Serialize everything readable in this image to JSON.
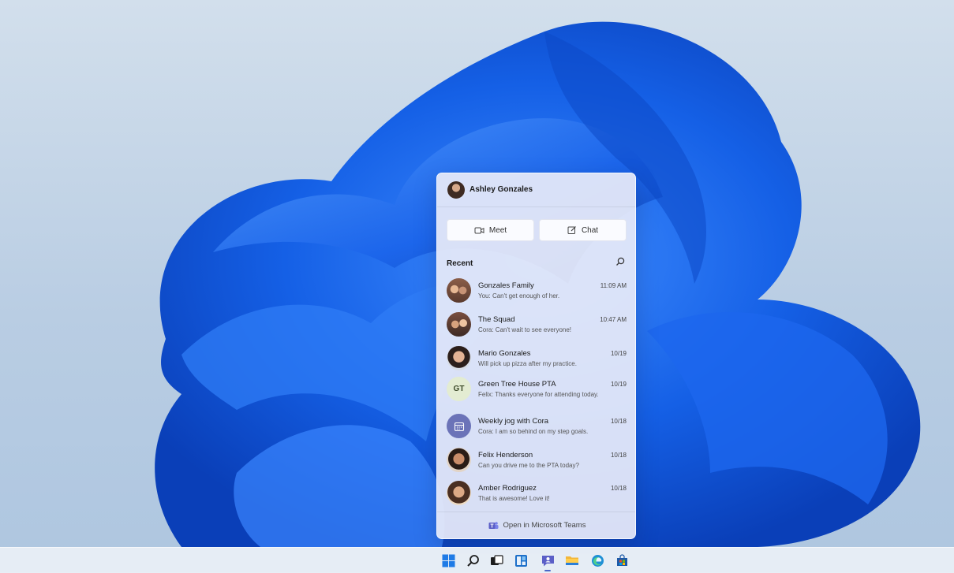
{
  "user": {
    "name": "Ashley Gonzales"
  },
  "actions": {
    "meet_label": "Meet",
    "chat_label": "Chat"
  },
  "recent": {
    "label": "Recent",
    "items": [
      {
        "title": "Gonzales Family",
        "time": "11:09 AM",
        "preview": "You: Can't get enough of her.",
        "avatar": "photo-group"
      },
      {
        "title": "The Squad",
        "time": "10:47 AM",
        "preview": "Cora: Can't wait to see everyone!",
        "avatar": "photo-group"
      },
      {
        "title": "Mario Gonzales",
        "time": "10/19",
        "preview": "Will pick up pizza after my practice.",
        "avatar": "photo"
      },
      {
        "title": "Green Tree House PTA",
        "time": "10/19",
        "preview": "Felix: Thanks everyone for attending today.",
        "avatar": "initials",
        "initials": "GT"
      },
      {
        "title": "Weekly jog with Cora",
        "time": "10/18",
        "preview": "Cora: I am so behind on my step goals.",
        "avatar": "calendar-icon"
      },
      {
        "title": "Felix Henderson",
        "time": "10/18",
        "preview": "Can you drive me to the PTA today?",
        "avatar": "photo"
      },
      {
        "title": "Amber Rodriguez",
        "time": "10/18",
        "preview": "That is awesome! Love it!",
        "avatar": "photo"
      }
    ]
  },
  "footer": {
    "label": "Open in Microsoft Teams"
  },
  "taskbar": {
    "icons": [
      "start-icon",
      "search-icon",
      "task-view-icon",
      "widgets-icon",
      "chat-icon",
      "file-explorer-icon",
      "edge-icon",
      "store-icon"
    ],
    "active": "chat-icon"
  },
  "colors": {
    "accent": "#4a67c9",
    "wallpaper_blue": "#1b5fe0",
    "teams_purple": "#5b5fc7"
  }
}
